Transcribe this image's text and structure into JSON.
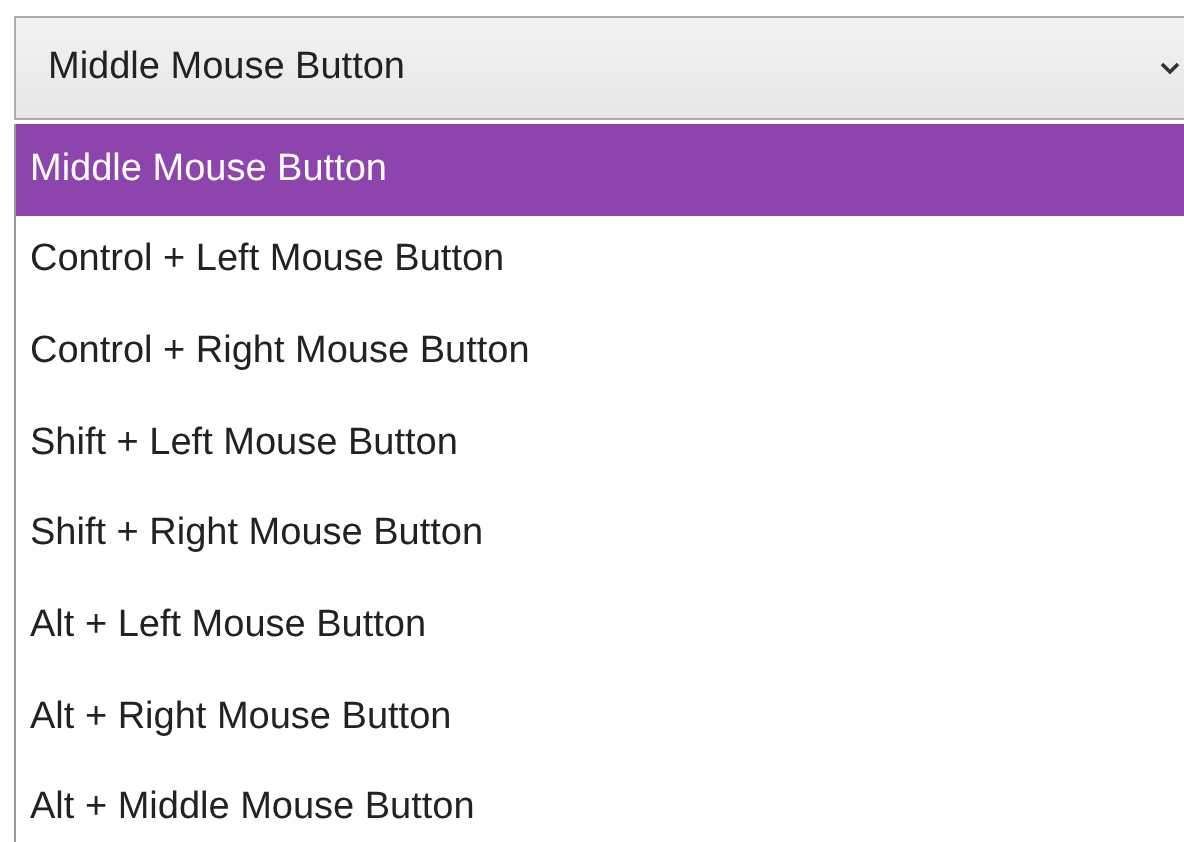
{
  "combo": {
    "value": "Middle Mouse Button",
    "expanded": true
  },
  "options": [
    {
      "label": "Middle Mouse Button",
      "selected": true
    },
    {
      "label": "Control + Left Mouse Button",
      "selected": false
    },
    {
      "label": "Control + Right Mouse Button",
      "selected": false
    },
    {
      "label": "Shift + Left Mouse Button",
      "selected": false
    },
    {
      "label": "Shift + Right Mouse Button",
      "selected": false
    },
    {
      "label": "Alt + Left Mouse Button",
      "selected": false
    },
    {
      "label": "Alt + Right Mouse Button",
      "selected": false
    },
    {
      "label": "Alt + Middle Mouse Button",
      "selected": false
    }
  ]
}
